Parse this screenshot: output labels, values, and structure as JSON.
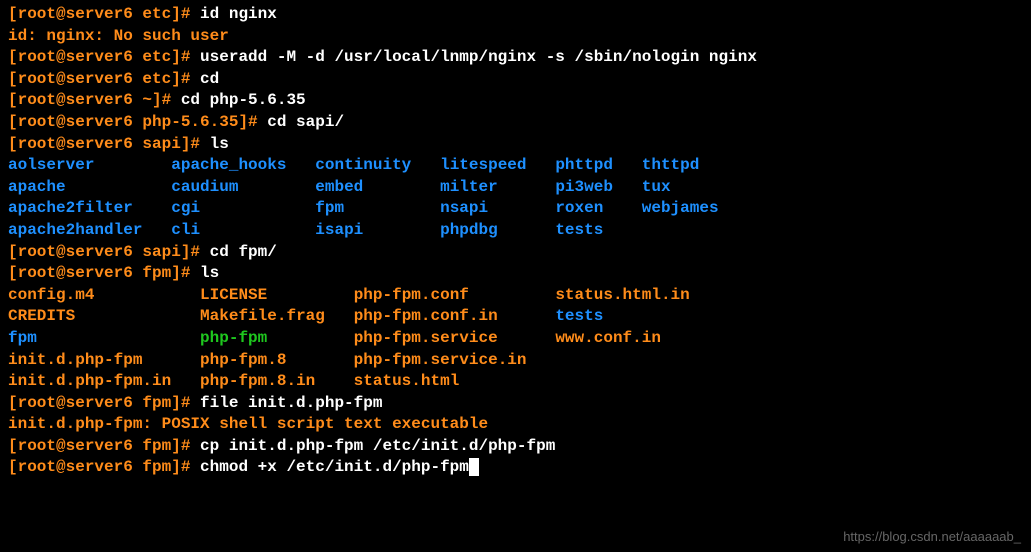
{
  "prompts": {
    "p1": "[root@server6 etc]# ",
    "p2": "[root@server6 ~]# ",
    "p3": "[root@server6 php-5.6.35]# ",
    "p4": "[root@server6 sapi]# ",
    "p5": "[root@server6 fpm]# "
  },
  "cmds": {
    "c1": "id nginx",
    "c2": "useradd -M -d /usr/local/lnmp/nginx -s /sbin/nologin nginx",
    "c3": "cd",
    "c4": "cd php-5.6.35",
    "c5": "cd sapi/",
    "c6": "ls",
    "c7": "cd fpm/",
    "c8": "ls",
    "c9": "file init.d.php-fpm",
    "c10": "cp init.d.php-fpm /etc/init.d/php-fpm",
    "c11": "chmod +x /etc/init.d/php-fpm"
  },
  "out": {
    "o1": "id: nginx: No such user",
    "o2": "init.d.php-fpm: POSIX shell script text executable"
  },
  "sapi": {
    "r1c1": "aolserver",
    "r1c2": "apache_hooks",
    "r1c3": "continuity",
    "r1c4": "litespeed",
    "r1c5": "phttpd",
    "r1c6": "thttpd",
    "r2c1": "apache",
    "r2c2": "caudium",
    "r2c3": "embed",
    "r2c4": "milter",
    "r2c5": "pi3web",
    "r2c6": "tux",
    "r3c1": "apache2filter",
    "r3c2": "cgi",
    "r3c3": "fpm",
    "r3c4": "nsapi",
    "r3c5": "roxen",
    "r3c6": "webjames",
    "r4c1": "apache2handler",
    "r4c2": "cli",
    "r4c3": "isapi",
    "r4c4": "phpdbg",
    "r4c5": "tests"
  },
  "fpm": {
    "a1": "config.m4",
    "a2": "LICENSE",
    "a3": "php-fpm.conf",
    "a4": "status.html.in",
    "b1": "CREDITS",
    "b2": "Makefile.frag",
    "b3": "php-fpm.conf.in",
    "b4": "tests",
    "c1": "fpm",
    "c2": "php-fpm",
    "c3": "php-fpm.service",
    "c4": "www.conf.in",
    "d1": "init.d.php-fpm",
    "d2": "php-fpm.8",
    "d3": "php-fpm.service.in",
    "e1": "init.d.php-fpm.in",
    "e2": "php-fpm.8.in",
    "e3": "status.html"
  },
  "watermark": "https://blog.csdn.net/aaaaaab_"
}
